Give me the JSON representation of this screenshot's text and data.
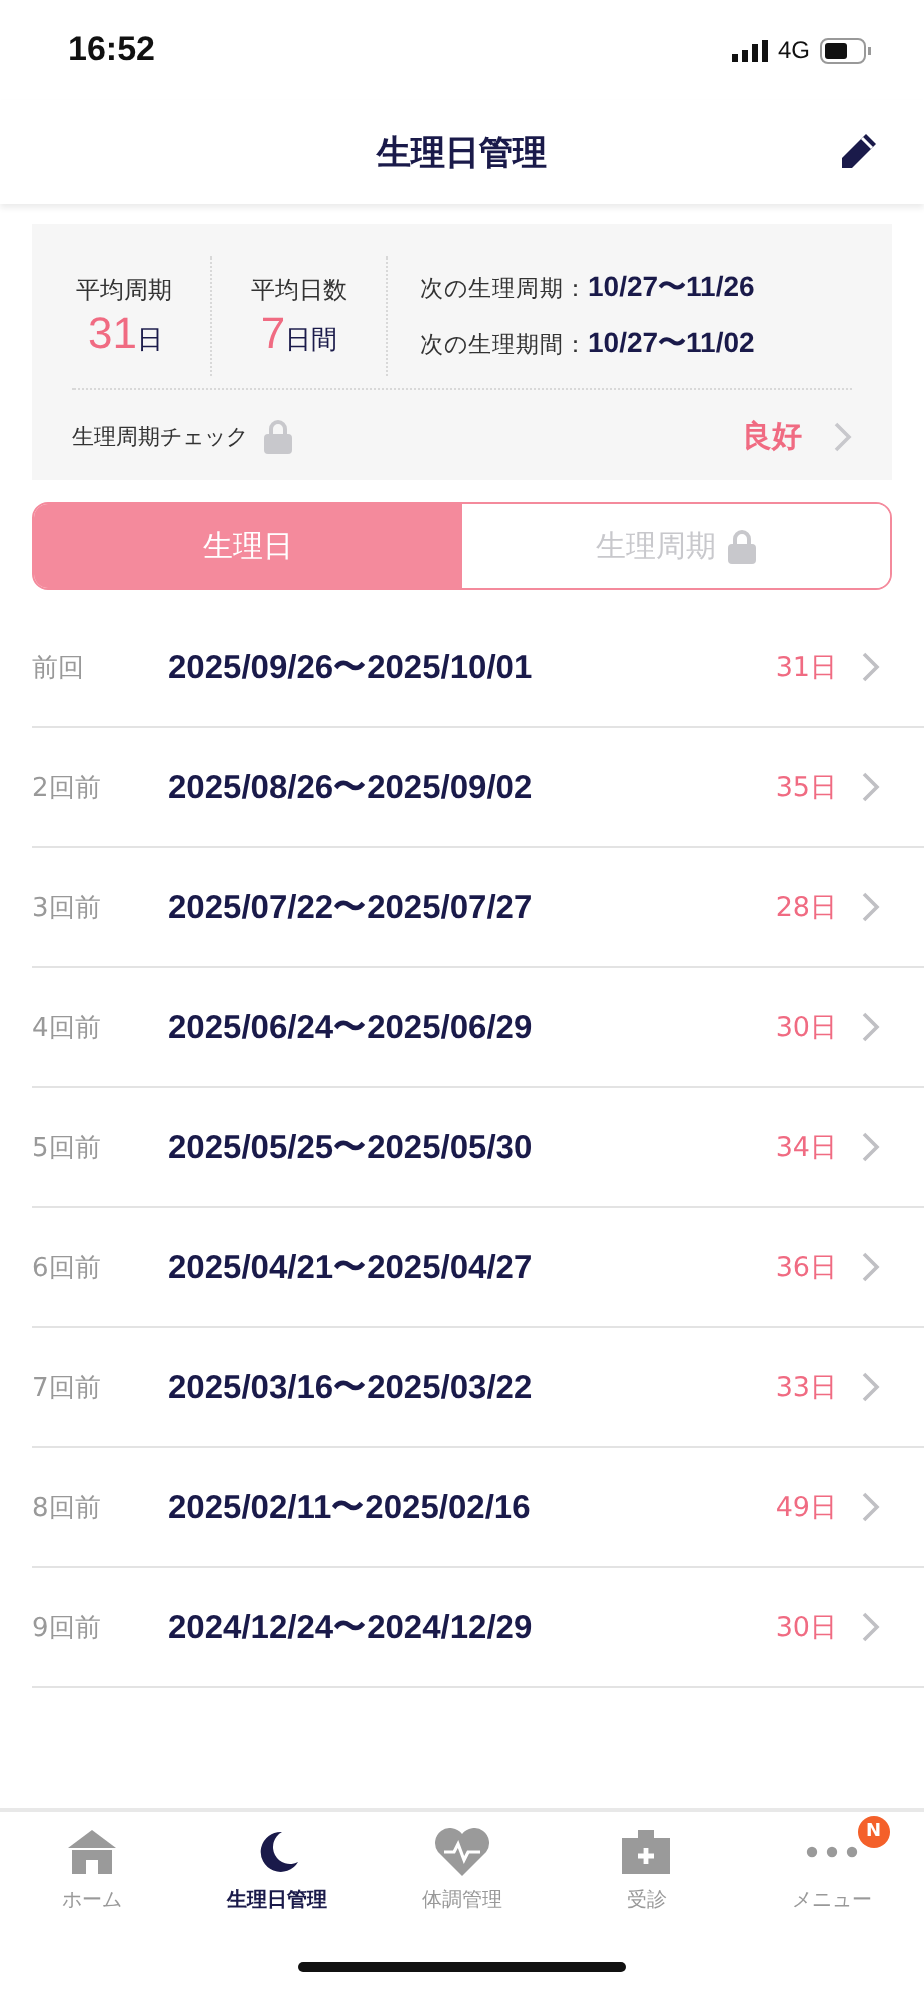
{
  "status_bar": {
    "time": "16:52",
    "network": "4G"
  },
  "header": {
    "title": "生理日管理"
  },
  "summary": {
    "avg_cycle": {
      "label": "平均周期",
      "value": "31",
      "unit": "日"
    },
    "avg_days": {
      "label": "平均日数",
      "value": "7",
      "unit": "日間"
    },
    "next": [
      {
        "label": "次の生理周期：",
        "value": "10/27〜11/26"
      },
      {
        "label": "次の生理期間：",
        "value": "10/27〜11/02"
      }
    ],
    "check": {
      "label": "生理周期チェック",
      "locked": true,
      "result": "良好"
    }
  },
  "segments": [
    {
      "label": "生理日",
      "selected": true,
      "locked": false
    },
    {
      "label": "生理周期",
      "selected": false,
      "locked": true
    }
  ],
  "history": [
    {
      "label": "前回",
      "range": "2025/09/26〜2025/10/01",
      "days": "31日"
    },
    {
      "label": "2回前",
      "range": "2025/08/26〜2025/09/02",
      "days": "35日"
    },
    {
      "label": "3回前",
      "range": "2025/07/22〜2025/07/27",
      "days": "28日"
    },
    {
      "label": "4回前",
      "range": "2025/06/24〜2025/06/29",
      "days": "30日"
    },
    {
      "label": "5回前",
      "range": "2025/05/25〜2025/05/30",
      "days": "34日"
    },
    {
      "label": "6回前",
      "range": "2025/04/21〜2025/04/27",
      "days": "36日"
    },
    {
      "label": "7回前",
      "range": "2025/03/16〜2025/03/22",
      "days": "33日"
    },
    {
      "label": "8回前",
      "range": "2025/02/11〜2025/02/16",
      "days": "49日"
    },
    {
      "label": "9回前",
      "range": "2024/12/24〜2024/12/29",
      "days": "30日"
    }
  ],
  "tab_bar": [
    {
      "kind": "home",
      "label": "ホーム",
      "selected": false
    },
    {
      "kind": "moon",
      "label": "生理日管理",
      "selected": true
    },
    {
      "kind": "heart",
      "label": "体調管理",
      "selected": false
    },
    {
      "kind": "clinic",
      "label": "受診",
      "selected": false
    },
    {
      "kind": "menu",
      "label": "メニュー",
      "selected": false,
      "badge": "N"
    }
  ]
}
